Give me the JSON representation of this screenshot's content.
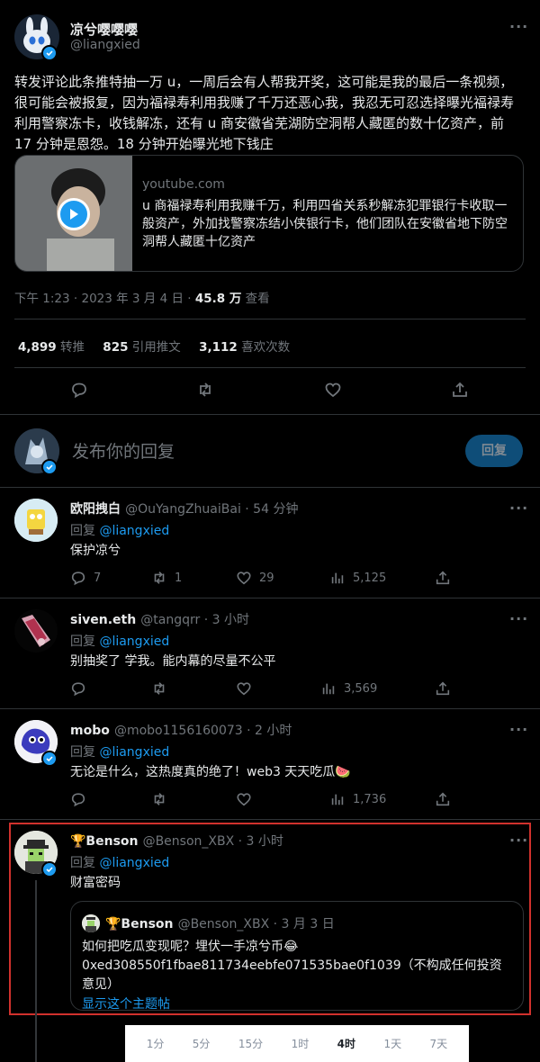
{
  "main_tweet": {
    "display_name": "凉兮嘤嘤嘤",
    "handle": "@liangxied",
    "text": "转发评论此条推特抽一万 u，一周后会有人帮我开奖，这可能是我的最后一条视频，很可能会被报复，因为福禄寿利用我赚了千万还恶心我，我忍无可忍选择曝光福禄寿利用警察冻卡，收钱解冻，还有 u 商安徽省芜湖防空洞帮人藏匿的数十亿资产，前 17 分钟是恩怨。18 分钟开始曝光地下钱庄",
    "card": {
      "domain": "youtube.com",
      "title": "u 商福禄寿利用我赚千万，利用四省关系秒解冻犯罪银行卡收取一般资产，外加找警察冻结小侠银行卡，他们团队在安徽省地下防空洞帮人藏匿十亿资产"
    },
    "timestamp": "下午 1:23 · 2023 年 3 月 4 日 · ",
    "views_count": "45.8 万",
    "views_label": " 查看",
    "stats": {
      "retweets_count": "4,899",
      "retweets_label": "转推",
      "quotes_count": "825",
      "quotes_label": "引用推文",
      "likes_count": "3,112",
      "likes_label": "喜欢次数"
    }
  },
  "reply_box": {
    "placeholder": "发布你的回复",
    "button": "回复"
  },
  "replies": [
    {
      "display_name": "欧阳拽白",
      "handle": "@OuYangZhuaiBai",
      "time": " · 54 分钟",
      "reply_prefix": "回复 ",
      "reply_to": "@liangxied",
      "text": "保护凉兮",
      "counts": {
        "reply": "7",
        "retweet": "1",
        "like": "29",
        "views": "5,125"
      }
    },
    {
      "display_name": "siven.eth",
      "handle": "@tangqrr",
      "time": " · 3 小时",
      "reply_prefix": "回复 ",
      "reply_to": "@liangxied",
      "text": "别抽奖了 学我。能内幕的尽量不公平",
      "counts": {
        "reply": "",
        "retweet": "",
        "like": "",
        "views": "3,569"
      }
    },
    {
      "display_name": "mobo",
      "handle": "@mobo1156160073",
      "time": " · 2 小时",
      "reply_prefix": "回复 ",
      "reply_to": "@liangxied",
      "text": "无论是什么，这热度真的绝了！web3 天天吃瓜🍉",
      "counts": {
        "reply": "",
        "retweet": "",
        "like": "",
        "views": "1,736"
      }
    },
    {
      "display_name": "🏆Benson",
      "handle": "@Benson_XBX",
      "time": " · 3 小时",
      "reply_prefix": "回复 ",
      "reply_to": "@liangxied",
      "text": "财富密码",
      "quoted": {
        "display_name": "🏆Benson",
        "handle": "@Benson_XBX",
        "time": " · 3 月 3 日",
        "text_line1": "如何把吃瓜变现呢？埋伏一手凉兮币😂",
        "text_line2": "0xed308550f1fbae811734eebfe071535bae0f1039（不构成任何投资",
        "text_line3": "意见）",
        "show_thread": "显示这个主题帖"
      }
    }
  ],
  "time_range_bar": {
    "options": [
      "1分",
      "5分",
      "15分",
      "1时",
      "4时",
      "1天",
      "7天"
    ],
    "selected": "4时"
  },
  "colors": {
    "background": "#000000",
    "text": "#e7e9ea",
    "muted": "#71767b",
    "accent": "#1d9bf0",
    "highlight_border": "#d0312d"
  }
}
